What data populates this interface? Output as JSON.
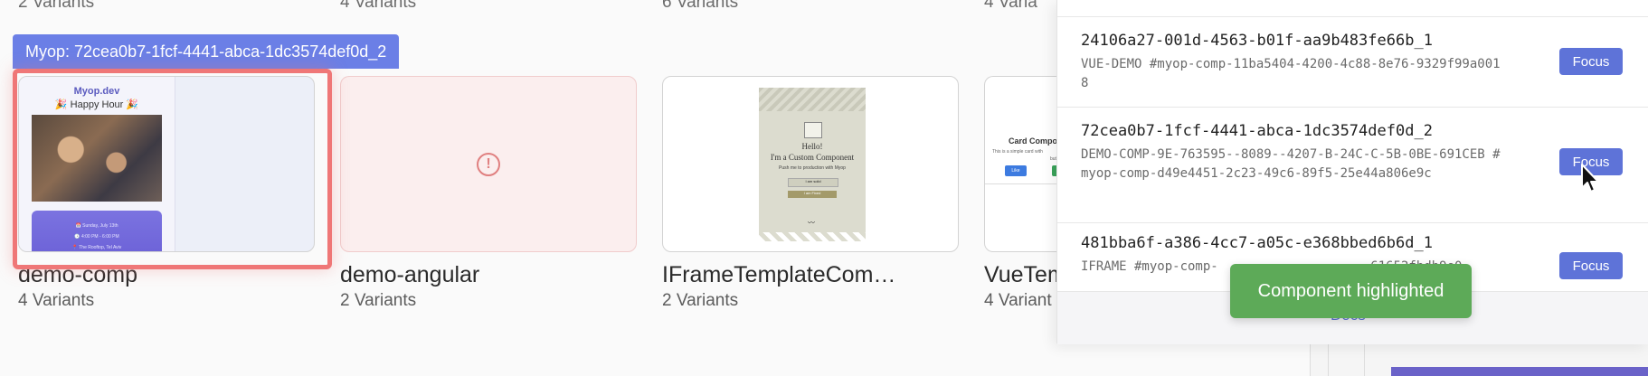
{
  "top_partial": [
    "2 Variants",
    "4 Variants",
    "6 Variants",
    "4 Varia"
  ],
  "highlight_tag": "Myop: 72cea0b7-1fcf-4441-abca-1dc3574def0d_2",
  "cards": [
    {
      "name": "demo-comp",
      "variants": "4 Variants",
      "preview": {
        "brand": "Myop.dev",
        "headline": "🎉 Happy Hour 🎉",
        "lines": [
          "📅 Sunday, July 13th",
          "🕓 4:00 PM - 6:00 PM",
          "📍 The Rooftop, Tel Aviv"
        ]
      }
    },
    {
      "name": "demo-angular",
      "variants": "2 Variants",
      "preview": {
        "icon": "!"
      }
    },
    {
      "name": "IFrameTemplateCom…",
      "variants": "2 Variants",
      "preview": {
        "hello": "Hello!",
        "title": "I'm a Custom Component",
        "subtitle": "Push me to production with Myop",
        "button1": "I am solid",
        "button2": "I am Fixed"
      }
    },
    {
      "name": "VueTem",
      "variants": "4 Variant",
      "preview": {
        "title": "Card Compo",
        "desc": "This is a simple card with",
        "desc2": "buttons.",
        "like": "Like"
      }
    }
  ],
  "panel": {
    "items": [
      {
        "id": "24106a27-001d-4563-b01f-aa9b483fe66b_1",
        "desc": "VUE-DEMO #myop-comp-11ba5404-4200-4c88-8e76-9329f99a0018",
        "button": "Focus"
      },
      {
        "id": "72cea0b7-1fcf-4441-abca-1dc3574def0d_2",
        "desc": "DEMO-COMP-9E-763595--8089--4207-B-24C-C-5B-0BE-691CEB #myop-comp-d49e4451-2c23-49c6-89f5-25e44a806e9c",
        "button": "Focus"
      },
      {
        "id": "481bba6f-a386-4cc7-a05c-e368bbed6b6d_1",
        "desc": "IFRAME #myop-comp-                    61652fbdb9e0",
        "button": "Focus"
      }
    ],
    "footer_link": "Docs"
  },
  "toast": "Component highlighted"
}
